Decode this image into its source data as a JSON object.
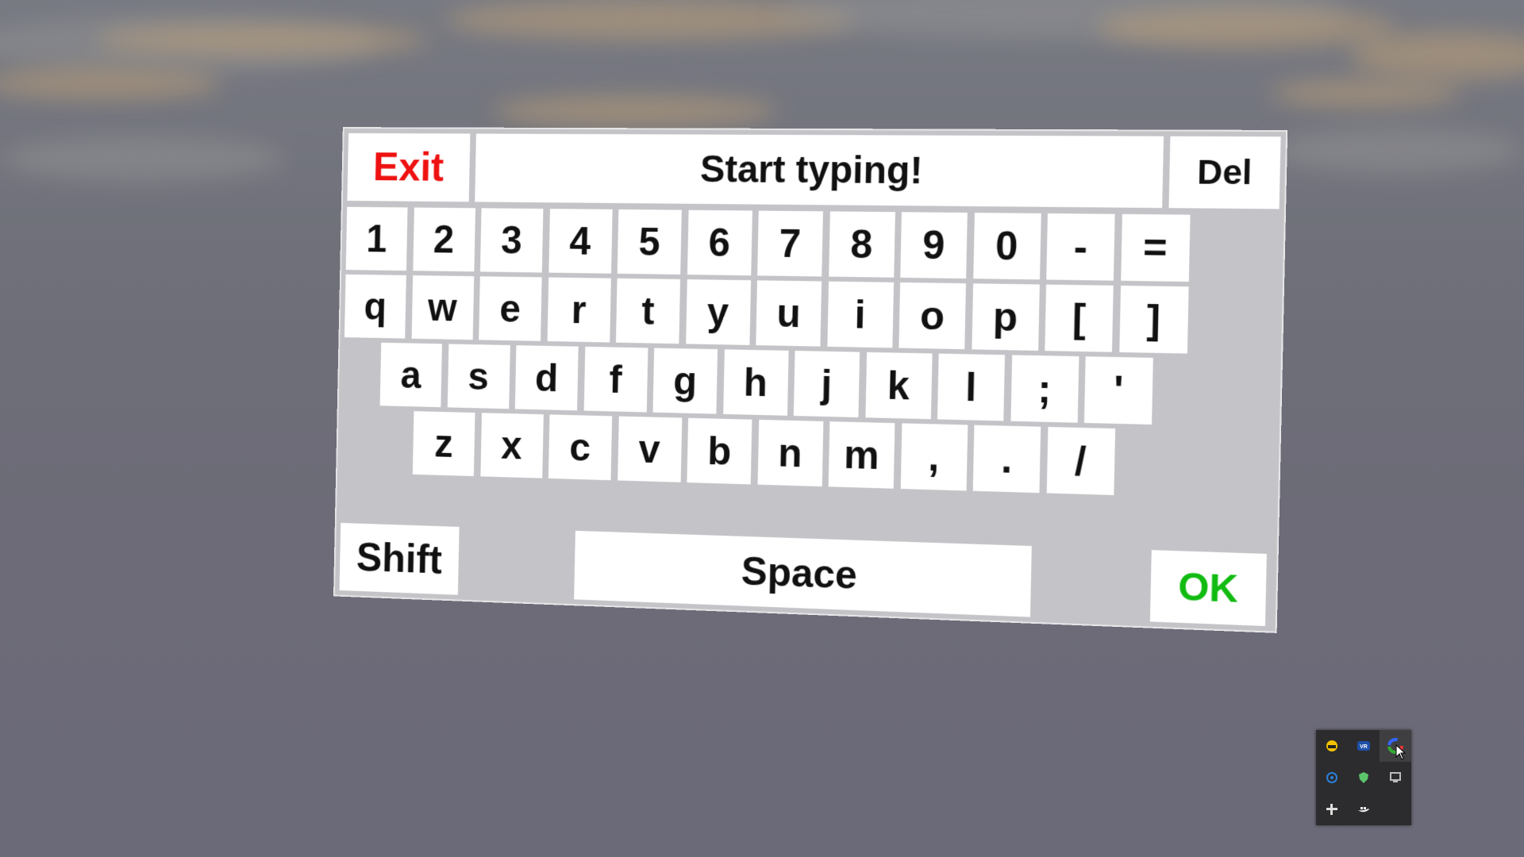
{
  "keyboard": {
    "exit_label": "Exit",
    "text_display": "Start typing!",
    "delete_label": "Del",
    "shift_label": "Shift",
    "space_label": "Space",
    "ok_label": "OK",
    "rows": [
      [
        "1",
        "2",
        "3",
        "4",
        "5",
        "6",
        "7",
        "8",
        "9",
        "0",
        "-",
        "="
      ],
      [
        "q",
        "w",
        "e",
        "r",
        "t",
        "y",
        "u",
        "i",
        "o",
        "p",
        "[",
        "]"
      ],
      [
        "a",
        "s",
        "d",
        "f",
        "g",
        "h",
        "j",
        "k",
        "l",
        ";",
        "'"
      ],
      [
        "z",
        "x",
        "c",
        "v",
        "b",
        "n",
        "m",
        ",",
        ".",
        "/"
      ]
    ],
    "colors": {
      "exit": "#ee1111",
      "ok": "#11bb11",
      "key_bg": "#ffffff",
      "panel_bg": "#c4c4c8"
    }
  },
  "tray": {
    "icons": [
      "headset-app-icon",
      "vr-app-icon",
      "color-wheel-icon",
      "network-icon",
      "security-shield-icon",
      "display-icon",
      "slack-icon",
      "docker-icon"
    ]
  }
}
